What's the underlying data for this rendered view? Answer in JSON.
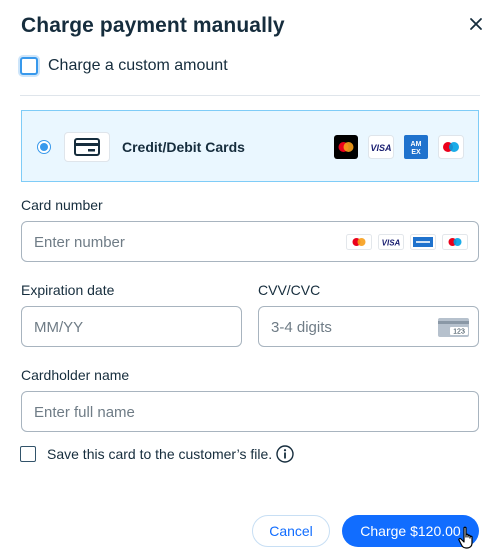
{
  "dialog": {
    "title": "Charge payment manually",
    "close_icon": "close-icon"
  },
  "custom_amount": {
    "label": "Charge a custom amount",
    "checked": false
  },
  "payment_method": {
    "label": "Credit/Debit Cards",
    "selected": true,
    "icon": "credit-card-icon",
    "brands": [
      "mastercard",
      "visa",
      "amex",
      "maestro"
    ]
  },
  "card_number": {
    "label": "Card number",
    "placeholder": "Enter number"
  },
  "expiration": {
    "label": "Expiration date",
    "placeholder": "MM/YY"
  },
  "cvv": {
    "label": "CVV/CVC",
    "placeholder": "3-4 digits",
    "icon_text": "123"
  },
  "cardholder": {
    "label": "Cardholder name",
    "placeholder": "Enter full name"
  },
  "save_card": {
    "label": "Save this card to the customer’s file.",
    "checked": false
  },
  "buttons": {
    "cancel": "Cancel",
    "charge": "Charge $120.00"
  },
  "colors": {
    "accent": "#116dff",
    "selected_bg": "#eaf7ff",
    "selected_border": "#7fccf7",
    "text": "#162d3d"
  }
}
